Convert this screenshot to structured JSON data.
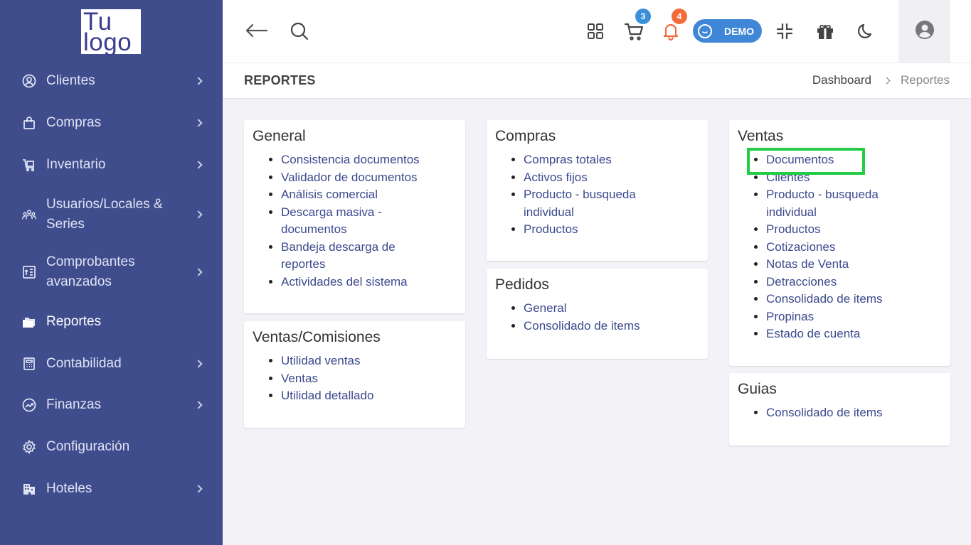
{
  "logo": {
    "line1": "Tu",
    "line2": "logo"
  },
  "sidebar": {
    "items": [
      {
        "label": "Clientes",
        "icon": "user-circle-icon",
        "has_children": true
      },
      {
        "label": "Compras",
        "icon": "shopping-bag-icon",
        "has_children": true
      },
      {
        "label": "Inventario",
        "icon": "cart-box-icon",
        "has_children": true
      },
      {
        "label": "Usuarios/Locales &",
        "label2": "Series",
        "icon": "users-icon",
        "has_children": true
      },
      {
        "label": "Comprobantes",
        "label2": "avanzados",
        "icon": "receipt-icon",
        "has_children": true
      },
      {
        "label": "Reportes",
        "icon": "folders-icon",
        "has_children": false,
        "active": true
      },
      {
        "label": "Contabilidad",
        "icon": "calculator-icon",
        "has_children": true
      },
      {
        "label": "Finanzas",
        "icon": "trend-icon",
        "has_children": true
      },
      {
        "label": "Configuración",
        "icon": "gear-icon",
        "has_children": false
      },
      {
        "label": "Hoteles",
        "icon": "building-icon",
        "has_children": true
      }
    ]
  },
  "topbar": {
    "cart_count": "3",
    "notifications_count": "4",
    "demo_label": "DEMO",
    "colors": {
      "cart_badge": "#3a8fd9",
      "notif_badge": "#f26b3a",
      "demo_pill": "#3f87d6"
    }
  },
  "page": {
    "title": "REPORTES",
    "breadcrumb": {
      "home": "Dashboard",
      "current": "Reportes"
    }
  },
  "cards": {
    "general": {
      "title": "General",
      "items": [
        "Consistencia documentos",
        "Validador de documentos",
        "Análisis comercial",
        "Descarga masiva -",
        "documentos",
        "Bandeja descarga de",
        "reportes",
        "Actividades del sistema"
      ]
    },
    "ventas_comisiones": {
      "title": "Ventas/Comisiones",
      "items": [
        "Utilidad ventas",
        "Ventas",
        "Utilidad detallado"
      ]
    },
    "compras": {
      "title": "Compras",
      "items": [
        "Compras totales",
        "Activos fijos",
        "Producto - busqueda",
        "individual",
        "Productos"
      ]
    },
    "pedidos": {
      "title": "Pedidos",
      "items": [
        "General",
        "Consolidado de items"
      ]
    },
    "ventas": {
      "title": "Ventas",
      "items": [
        "Documentos",
        "Clientes",
        "Producto - busqueda",
        "individual",
        "Productos",
        "Cotizaciones",
        "Notas de Venta",
        "Detracciones",
        "Consolidado de items",
        "Propinas",
        "Estado de cuenta"
      ]
    },
    "guias": {
      "title": "Guias",
      "items": [
        "Consolidado de items"
      ]
    }
  },
  "colors": {
    "sidebar_bg": "#3f4d8d",
    "link": "#3b4a8d",
    "highlight": "#22cc44"
  }
}
